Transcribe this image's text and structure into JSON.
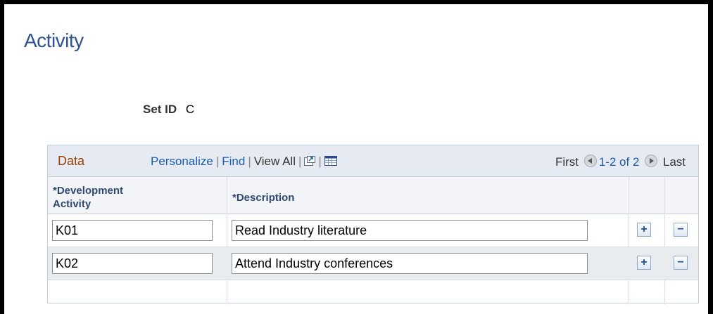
{
  "page": {
    "title": "Activity"
  },
  "setid": {
    "label": "Set ID",
    "value": "C"
  },
  "grid": {
    "title": "Data",
    "links": {
      "personalize": "Personalize",
      "find": "Find",
      "view_all": "View All"
    },
    "pager": {
      "first": "First",
      "range": "1-2 of 2",
      "last": "Last"
    },
    "columns": {
      "activity": [
        "*Development",
        "Activity"
      ],
      "description": "*Description"
    },
    "rows": [
      {
        "activity": "K01",
        "description": "Read Industry literature"
      },
      {
        "activity": "K02",
        "description": "Attend Industry conferences"
      }
    ],
    "add_symbol": "+",
    "delete_symbol": "−"
  },
  "icons": {
    "zoom": "new-window-icon",
    "download": "spreadsheet-icon",
    "prev": "previous-arrow-icon",
    "next": "next-arrow-icon"
  },
  "colors": {
    "title_blue": "#2f5290",
    "link_blue": "#1c5ba8",
    "grid_title": "#9b3f05",
    "toolbar_bg": "#e6ebf3"
  }
}
